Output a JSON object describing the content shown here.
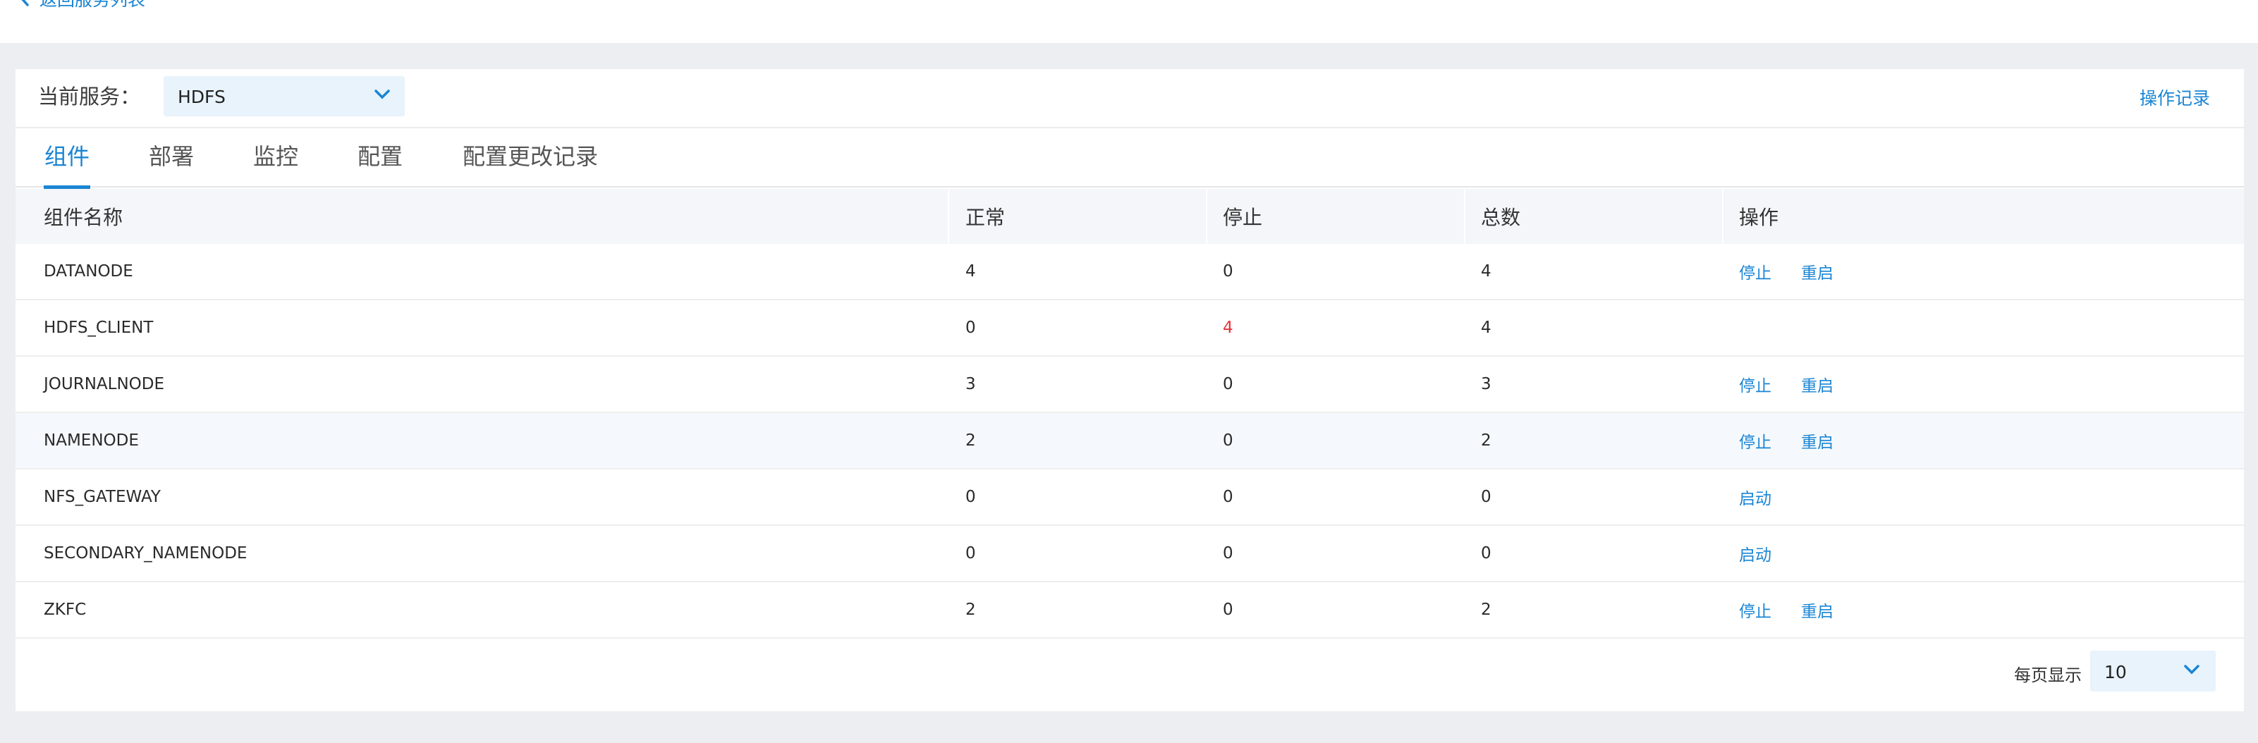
{
  "nav": {
    "back_label": "返回服务列表"
  },
  "service": {
    "label": "当前服务：",
    "selected": "HDFS",
    "op_record": "操作记录"
  },
  "tabs": [
    {
      "label": "组件",
      "active": true
    },
    {
      "label": "部署",
      "active": false
    },
    {
      "label": "监控",
      "active": false
    },
    {
      "label": "配置",
      "active": false
    },
    {
      "label": "配置更改记录",
      "active": false
    }
  ],
  "table": {
    "headers": [
      "组件名称",
      "正常",
      "停止",
      "总数",
      "操作"
    ],
    "rows": [
      {
        "name": "DATANODE",
        "normal": "4",
        "stopped": "0",
        "total": "4",
        "actions": [
          "停止",
          "重启"
        ]
      },
      {
        "name": "HDFS_CLIENT",
        "normal": "0",
        "stopped": "4",
        "total": "4",
        "actions": []
      },
      {
        "name": "JOURNALNODE",
        "normal": "3",
        "stopped": "0",
        "total": "3",
        "actions": [
          "停止",
          "重启"
        ]
      },
      {
        "name": "NAMENODE",
        "normal": "2",
        "stopped": "0",
        "total": "2",
        "actions": [
          "停止",
          "重启"
        ]
      },
      {
        "name": "NFS_GATEWAY",
        "normal": "0",
        "stopped": "0",
        "total": "0",
        "actions": [
          "启动"
        ]
      },
      {
        "name": "SECONDARY_NAMENODE",
        "normal": "0",
        "stopped": "0",
        "total": "0",
        "actions": [
          "启动"
        ]
      },
      {
        "name": "ZKFC",
        "normal": "2",
        "stopped": "0",
        "total": "2",
        "actions": [
          "停止",
          "重启"
        ]
      }
    ]
  },
  "pagination": {
    "label": "每页显示",
    "page_size": "10"
  },
  "colors": {
    "accent": "#1a85d4",
    "alert": "#e0383d",
    "select_bg": "#e8f3fc",
    "page_bg": "#eceef2"
  },
  "icons": {
    "back": "chevron-left-icon",
    "dropdown": "chevron-down-icon"
  }
}
